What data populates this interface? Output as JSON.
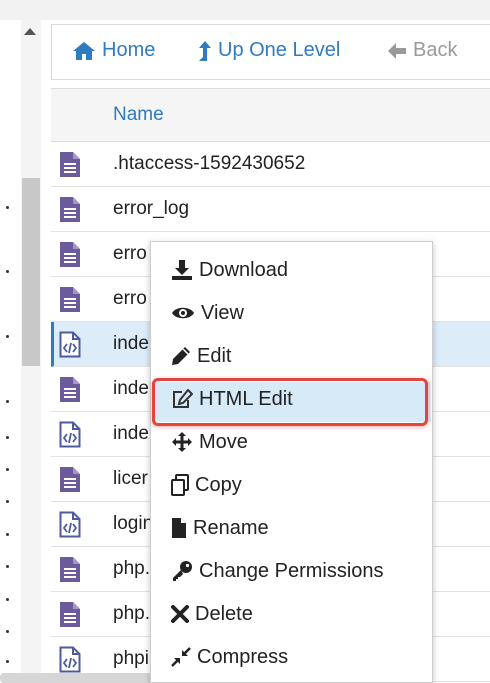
{
  "toolbar": {
    "home_label": "Home",
    "up_label": "Up One Level",
    "back_label": "Back"
  },
  "table": {
    "header_name": "Name",
    "rows": [
      {
        "name": ".htaccess-1592430652",
        "icon": "text-file-icon"
      },
      {
        "name": "error_log",
        "icon": "text-file-icon"
      },
      {
        "name": "erro",
        "icon": "text-file-icon"
      },
      {
        "name": "erro",
        "icon": "text-file-icon"
      },
      {
        "name": "inde",
        "icon": "code-file-icon",
        "selected": true
      },
      {
        "name": "inde",
        "icon": "text-file-icon"
      },
      {
        "name": "inde",
        "icon": "code-file-icon"
      },
      {
        "name": "licer",
        "icon": "text-file-icon"
      },
      {
        "name": "login",
        "icon": "code-file-icon"
      },
      {
        "name": "php.",
        "icon": "text-file-icon"
      },
      {
        "name": "php.",
        "icon": "text-file-icon"
      },
      {
        "name": "phpi",
        "icon": "code-file-icon"
      }
    ]
  },
  "context_menu": {
    "items": [
      {
        "label": "Download",
        "icon": "download-icon"
      },
      {
        "label": "View",
        "icon": "eye-icon"
      },
      {
        "label": "Edit",
        "icon": "pencil-icon"
      },
      {
        "label": "HTML Edit",
        "icon": "edit-square-icon",
        "highlighted": true
      },
      {
        "label": "Move",
        "icon": "move-arrows-icon"
      },
      {
        "label": "Copy",
        "icon": "copy-icon"
      },
      {
        "label": "Rename",
        "icon": "file-icon"
      },
      {
        "label": "Change Permissions",
        "icon": "key-icon"
      },
      {
        "label": "Delete",
        "icon": "x-icon"
      },
      {
        "label": "Compress",
        "icon": "compress-icon"
      }
    ]
  },
  "colors": {
    "link_blue": "#2e7cbf",
    "file_icon_purple": "#6b5a9c",
    "highlight_bg": "#d6eaf8",
    "annotation_red": "#e0463c"
  }
}
